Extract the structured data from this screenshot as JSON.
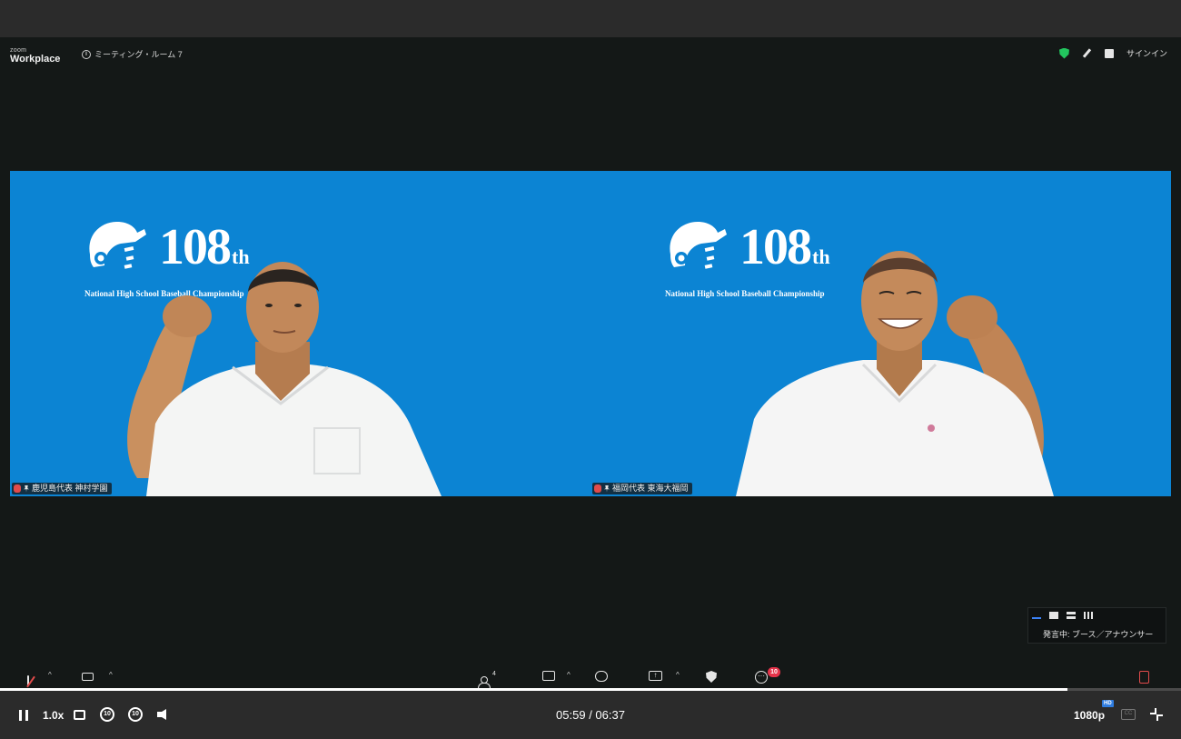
{
  "zoom": {
    "brand": "zoom",
    "product": "Workplace",
    "meeting_title": "ミーティング・ルーム 7",
    "signin_label": "サインイン"
  },
  "banner": {
    "number": "108",
    "suffix": "th",
    "subtitle_left": "National High School Baseball Championship",
    "subtitle_right": "National High School Baseball Championship"
  },
  "participants": [
    {
      "name": "鹿児島代表 神村学園"
    },
    {
      "name": "福岡代表 東海大福岡"
    }
  ],
  "layout_panel": {
    "label": "発言中: ブース／アナウンサー"
  },
  "toolbar": {
    "participants_count": "4",
    "notification_count": "10"
  },
  "player": {
    "speed": "1.0x",
    "skip_back": "10",
    "skip_forward": "10",
    "current_time": "05:59",
    "duration": "06:37",
    "time_display": "05:59 / 06:37",
    "quality": "1080p",
    "hd_badge": "HD",
    "cc_label": "CC",
    "progress": 0.904
  },
  "colors": {
    "tile_blue": "#0c84d3",
    "accent_green": "#22c55e",
    "badge_red": "#e5334a",
    "hd_blue": "#2f7de1"
  }
}
